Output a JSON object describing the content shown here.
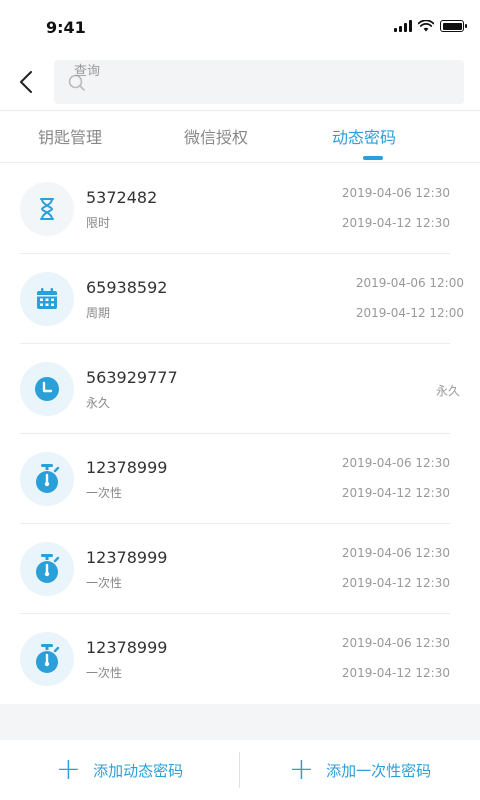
{
  "status": {
    "time": "9:41"
  },
  "search": {
    "placeholder": "查询"
  },
  "tabs": [
    {
      "label": "钥匙管理"
    },
    {
      "label": "微信授权"
    },
    {
      "label": "动态密码",
      "active": true
    }
  ],
  "passwords": [
    {
      "code": "5372482",
      "type": "限时",
      "start": "2019-04-06 12:30",
      "end": "2019-04-12 12:30",
      "icon": "hourglass-icon"
    },
    {
      "code": "65938592",
      "type": "周期",
      "start": "2019-04-06 12:00",
      "end": "2019-04-12 12:00",
      "icon": "calendar-icon"
    },
    {
      "code": "563929777",
      "type": "永久",
      "start": "永久",
      "icon": "clock-icon"
    },
    {
      "code": "12378999",
      "type": "一次性",
      "start": "2019-04-06 12:30",
      "end": "2019-04-12 12:30",
      "icon": "stopwatch-icon"
    },
    {
      "code": "12378999",
      "type": "一次性",
      "start": "2019-04-06 12:30",
      "end": "2019-04-12 12:30",
      "icon": "stopwatch-icon"
    },
    {
      "code": "12378999",
      "type": "一次性",
      "start": "2019-04-06 12:30",
      "end": "2019-04-12 12:30",
      "icon": "stopwatch-icon"
    }
  ],
  "actions": {
    "add_dynamic": "添加动态密码",
    "add_once": "添加一次性密码"
  },
  "colors": {
    "accent": "#2a9fd8",
    "icon_bg": "#e9f4fb"
  }
}
